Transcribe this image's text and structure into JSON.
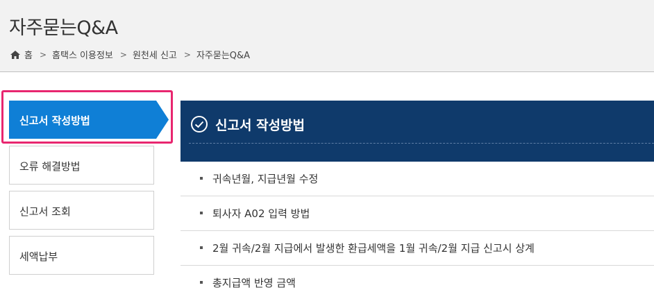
{
  "header": {
    "title": "자주묻는Q&A",
    "breadcrumb": [
      "홈",
      "홈택스 이용정보",
      "원천세 신고",
      "자주묻는Q&A"
    ]
  },
  "sidebar": {
    "items": [
      {
        "label": "신고서 작성방법",
        "active": true
      },
      {
        "label": "오류 해결방법",
        "active": false
      },
      {
        "label": "신고서 조회",
        "active": false
      },
      {
        "label": "세액납부",
        "active": false
      }
    ]
  },
  "main": {
    "section_title": "신고서 작성방법",
    "items": [
      "귀속년월, 지급년월 수정",
      "퇴사자 A02 입력 방법",
      "2월 귀속/2월 지급에서 발생한 환급세액을 1월 귀속/2월 지급 신고시 상계",
      "총지급액 반영 금액"
    ]
  },
  "colors": {
    "active_tab": "#0f7fd6",
    "section_header": "#0f3a6b",
    "highlight_border": "#e8266f"
  },
  "icons": {
    "home": "home-icon",
    "breadcrumb_separator": "chevron-right-icon",
    "section_check": "check-circle-icon"
  }
}
